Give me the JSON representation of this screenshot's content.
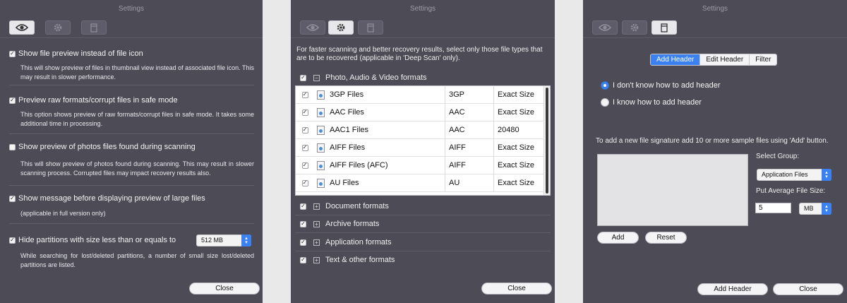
{
  "window_title": "Settings",
  "panel1": {
    "options": [
      {
        "label": "Show file preview instead of file icon",
        "checked": true,
        "desc": "This will show preview of files in thumbnail view instead of associated file icon. This may result in slower performance."
      },
      {
        "label": "Preview raw formats/corrupt files in safe mode",
        "checked": true,
        "desc": "This option shows preview of raw formats/corrupt files in safe mode. It takes some additional time in processing."
      },
      {
        "label": "Show preview of photos files found during scanning",
        "checked": false,
        "desc": "This will show preview of photos found during scanning. This may result in slower scanning process. Corrupted files may impact recovery results also."
      },
      {
        "label": "Show message before displaying preview of large files",
        "checked": true,
        "desc": "(applicable in full version only)"
      },
      {
        "label": "Hide partitions with size less than or equals to",
        "checked": true,
        "desc": "While searching for lost/deleted partitions, a number of small size lost/deleted partitions are listed."
      }
    ],
    "partition_size": "512 MB",
    "close_label": "Close"
  },
  "panel2": {
    "intro": "For faster scanning and better recovery results, select only those file types that are to be recovered (applicable in 'Deep Scan' only).",
    "expanded_group": "Photo, Audio & Video formats",
    "rows": [
      {
        "name": "3GP Files",
        "ext": "3GP",
        "size": "Exact Size"
      },
      {
        "name": "AAC Files",
        "ext": "AAC",
        "size": "Exact Size"
      },
      {
        "name": "AAC1 Files",
        "ext": "AAC",
        "size": "20480"
      },
      {
        "name": "AIFF Files",
        "ext": "AIFF",
        "size": "Exact Size"
      },
      {
        "name": "AIFF Files (AFC)",
        "ext": "AIFF",
        "size": "Exact Size"
      },
      {
        "name": "AU Files",
        "ext": "AU",
        "size": "Exact Size"
      }
    ],
    "groups": [
      "Document formats",
      "Archive formats",
      "Application formats",
      "Text & other formats"
    ],
    "close_label": "Close"
  },
  "panel3": {
    "tabs": [
      "Add Header",
      "Edit Header",
      "Filter"
    ],
    "active_tab": "Add Header",
    "radio_1": "I don't know how to add header",
    "radio_2": "I know how to add header",
    "info": "To add a new file signature add 10 or more sample files using 'Add' button.",
    "select_group_label": "Select Group:",
    "select_group_value": "Application Files",
    "avg_size_label": "Put Average File Size:",
    "avg_size_value": "5",
    "avg_size_unit": "MB",
    "add_label": "Add",
    "reset_label": "Reset",
    "add_header_label": "Add Header",
    "close_label": "Close"
  },
  "icons": [
    "eye-icon",
    "gear-icon",
    "document-icon",
    "checkmark-icon",
    "expand-icon",
    "collapse-icon",
    "file-icon",
    "chevron-updown-icon"
  ],
  "colors": {
    "panel_bg": "#4c4b56",
    "accent": "#3b82f0",
    "gap_bg": "#e9e9e9"
  }
}
